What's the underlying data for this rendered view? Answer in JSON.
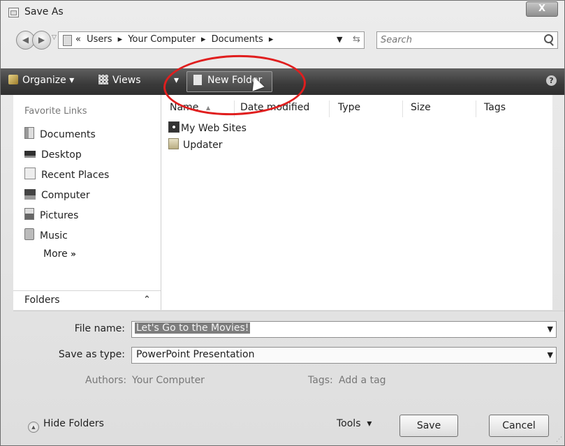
{
  "window": {
    "title": "Save As",
    "close_label": "X"
  },
  "navigation": {
    "breadcrumb": [
      "«",
      "Users",
      "▸",
      "Your Computer",
      "▸",
      "Documents",
      "▸"
    ],
    "search_placeholder": "Search"
  },
  "toolbar": {
    "organize_label": "Organize",
    "views_label": "Views",
    "new_folder_label": "New Folder",
    "help_label": "?"
  },
  "sidebar": {
    "favorites_title": "Favorite Links",
    "items": [
      {
        "label": "Documents",
        "icon": "documents-icon"
      },
      {
        "label": "Desktop",
        "icon": "desktop-icon"
      },
      {
        "label": "Recent Places",
        "icon": "recent-places-icon"
      },
      {
        "label": "Computer",
        "icon": "computer-icon"
      },
      {
        "label": "Pictures",
        "icon": "pictures-icon"
      },
      {
        "label": "Music",
        "icon": "music-icon"
      }
    ],
    "more_label": "More",
    "more_chevron": "»",
    "folders_label": "Folders"
  },
  "file_list": {
    "columns": [
      "Name",
      "Date modified",
      "Type",
      "Size",
      "Tags"
    ],
    "files": [
      {
        "name": "My Web Sites",
        "icon": "web-folder-icon"
      },
      {
        "name": "Updater",
        "icon": "folder-icon"
      }
    ]
  },
  "form": {
    "file_name_label": "File name:",
    "file_name_value": "Let's Go to the Movies!",
    "save_type_label": "Save as type:",
    "save_type_value": "PowerPoint Presentation",
    "authors_label": "Authors:",
    "authors_value": "Your Computer",
    "tags_label": "Tags:",
    "tags_value": "Add a tag"
  },
  "footer": {
    "hide_folders_label": "Hide Folders",
    "tools_label": "Tools",
    "save_label": "Save",
    "cancel_label": "Cancel"
  },
  "colors": {
    "toolbar_dark": "#3a3a3a",
    "highlight_circle": "#e01e1e"
  }
}
